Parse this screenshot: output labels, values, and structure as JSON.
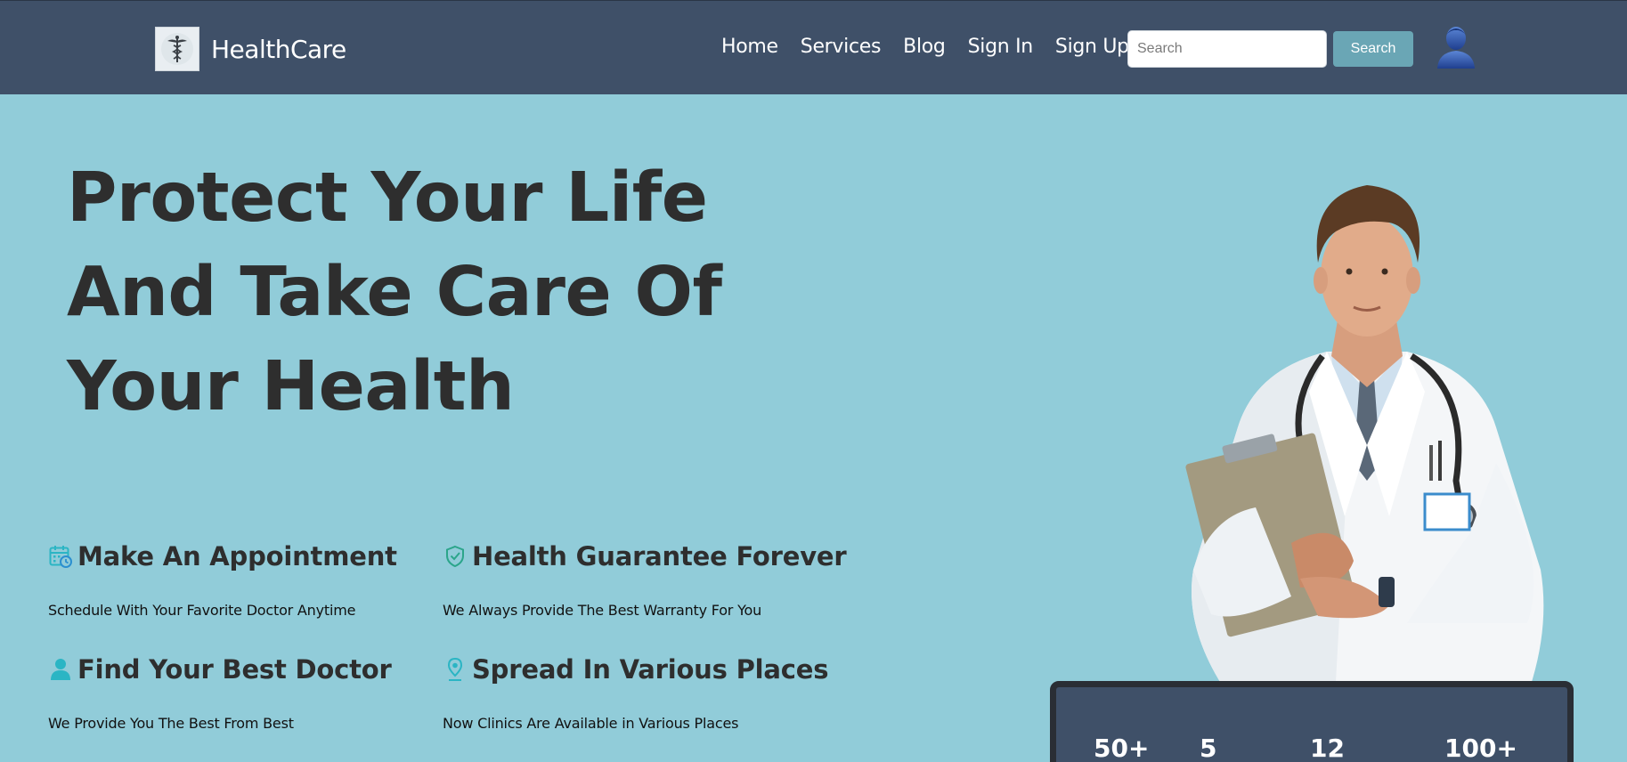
{
  "brand": {
    "name": "HealthCare",
    "logo_icon": "caduceus-icon"
  },
  "nav": {
    "links": [
      {
        "label": "Home"
      },
      {
        "label": "Services"
      },
      {
        "label": "Blog"
      },
      {
        "label": "Sign In"
      },
      {
        "label": "Sign Up"
      }
    ]
  },
  "search": {
    "placeholder": "Search",
    "value": "",
    "button_label": "Search"
  },
  "user": {
    "avatar_icon": "user-avatar-icon"
  },
  "hero": {
    "title": "Protect Your Life And Take Care Of Your Health"
  },
  "features": [
    {
      "icon": "calendar-clock-icon",
      "title": "Make An Appointment",
      "description": "Schedule With Your Favorite Doctor Anytime"
    },
    {
      "icon": "shield-check-icon",
      "title": "Health Guarantee Forever",
      "description": "We Always Provide The Best Warranty For You"
    },
    {
      "icon": "person-icon",
      "title": "Find Your Best Doctor",
      "description": "We Provide You The Best From Best"
    },
    {
      "icon": "map-pin-icon",
      "title": "Spread In Various Places",
      "description": "Now Clinics Are Available in Various Places"
    }
  ],
  "stats": [
    {
      "value": "50+"
    },
    {
      "value": "5"
    },
    {
      "value": "12"
    },
    {
      "value": "100+"
    }
  ],
  "colors": {
    "navbar": "#3f5068",
    "page_background": "#91ccd9",
    "search_button": "#6aa6b5",
    "heading_text": "#2e2e2e",
    "icon_accent": "#2bb5c4"
  }
}
